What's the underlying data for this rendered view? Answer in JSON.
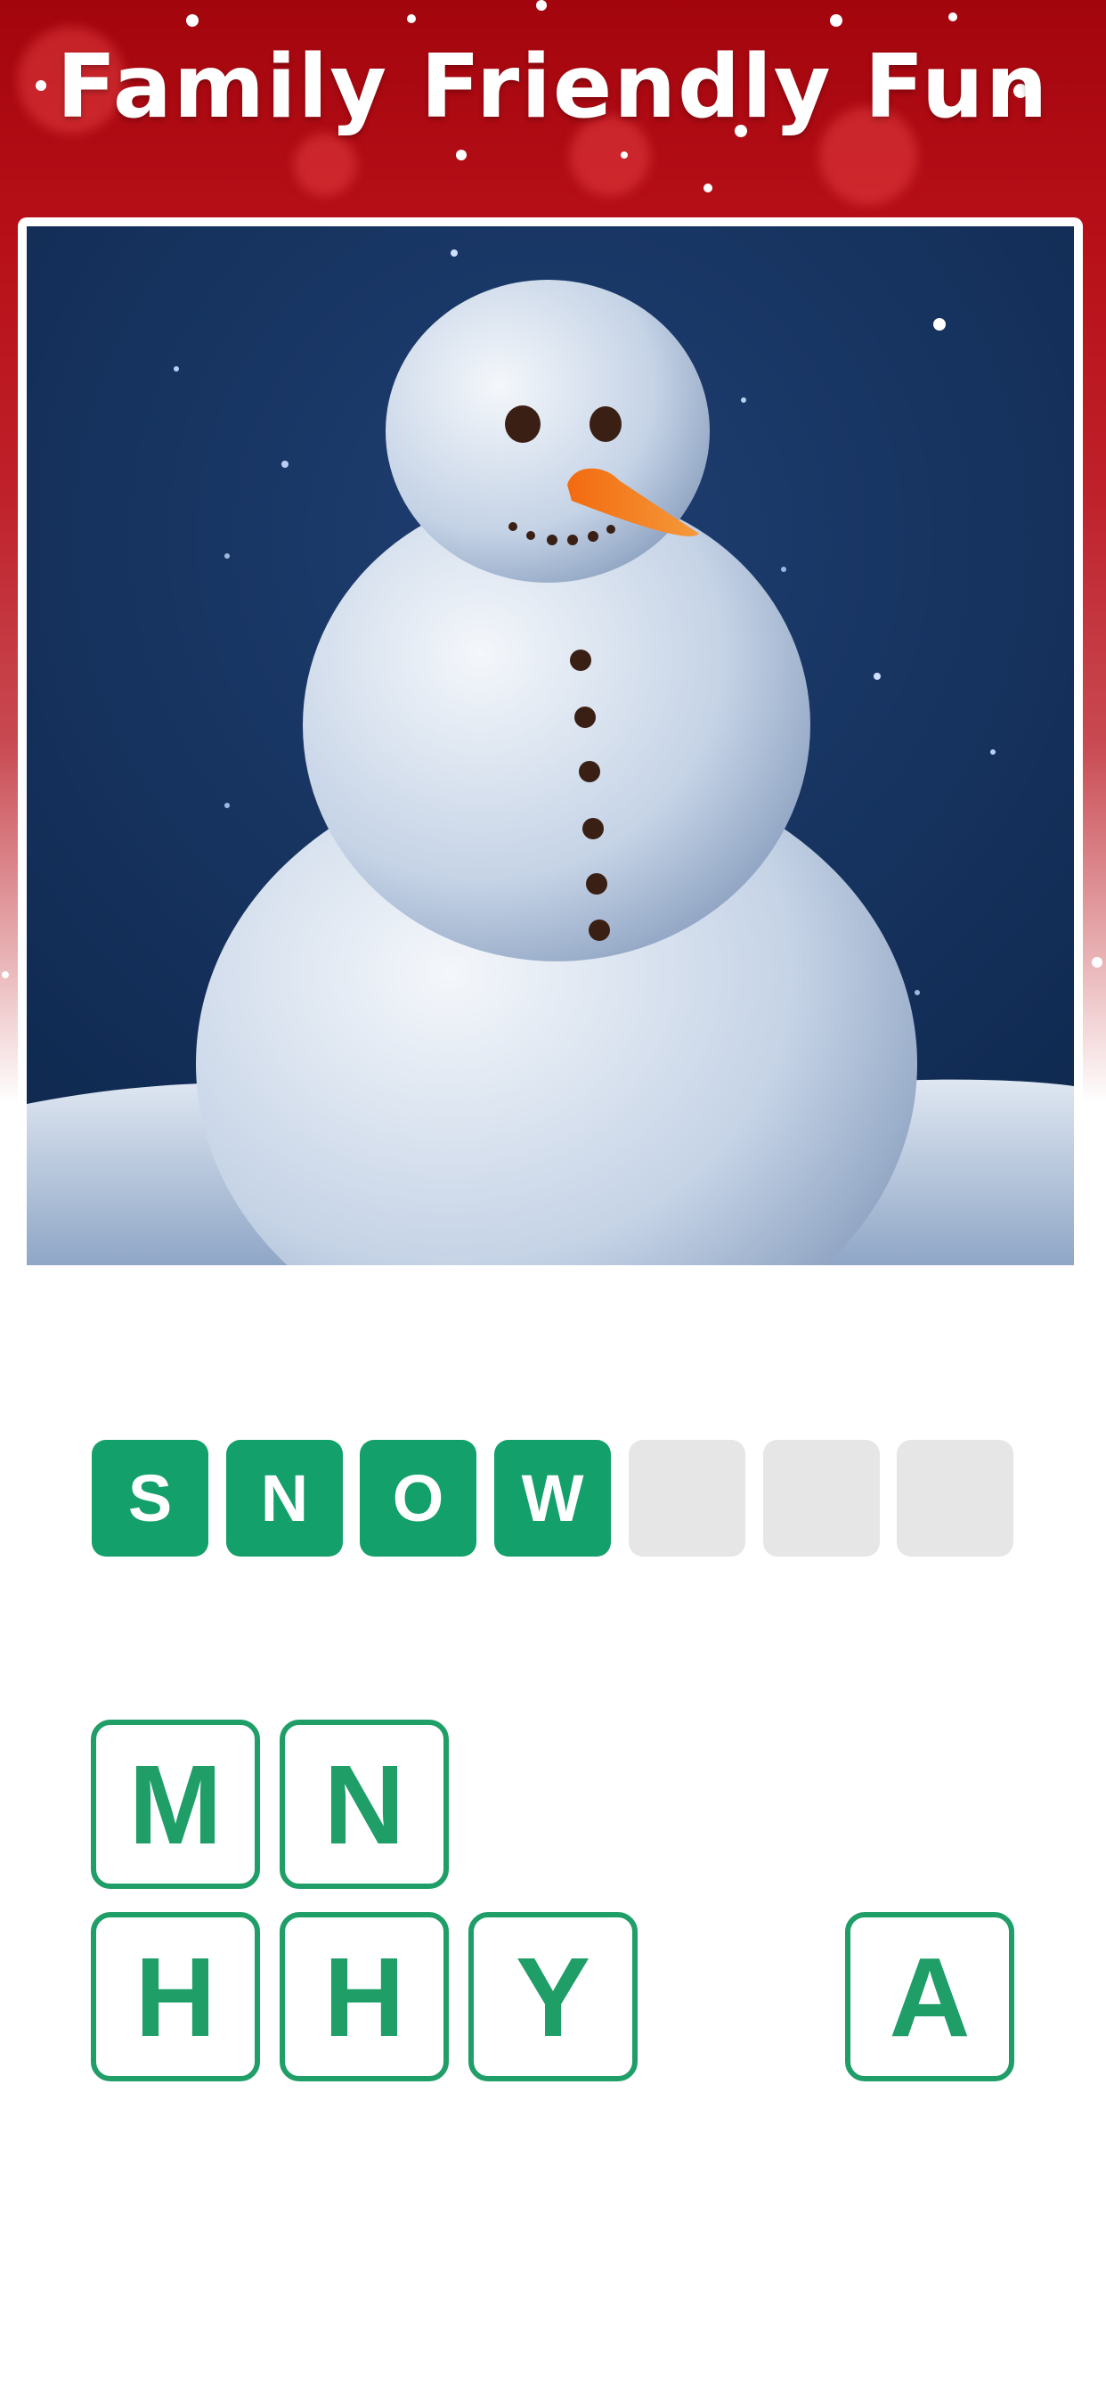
{
  "header": {
    "title": "Family Friendly Fun",
    "background_color": "#b3101a"
  },
  "puzzle_image": {
    "subject": "snowman"
  },
  "answer": {
    "slots": [
      "S",
      "N",
      "O",
      "W",
      "",
      "",
      ""
    ],
    "filled_color": "#14a06a",
    "empty_color": "#e6e6e6"
  },
  "letter_tiles": {
    "row1": [
      "M",
      "N"
    ],
    "row2": [
      "H",
      "H",
      "Y",
      "A"
    ],
    "accent_color": "#1f9e68"
  }
}
